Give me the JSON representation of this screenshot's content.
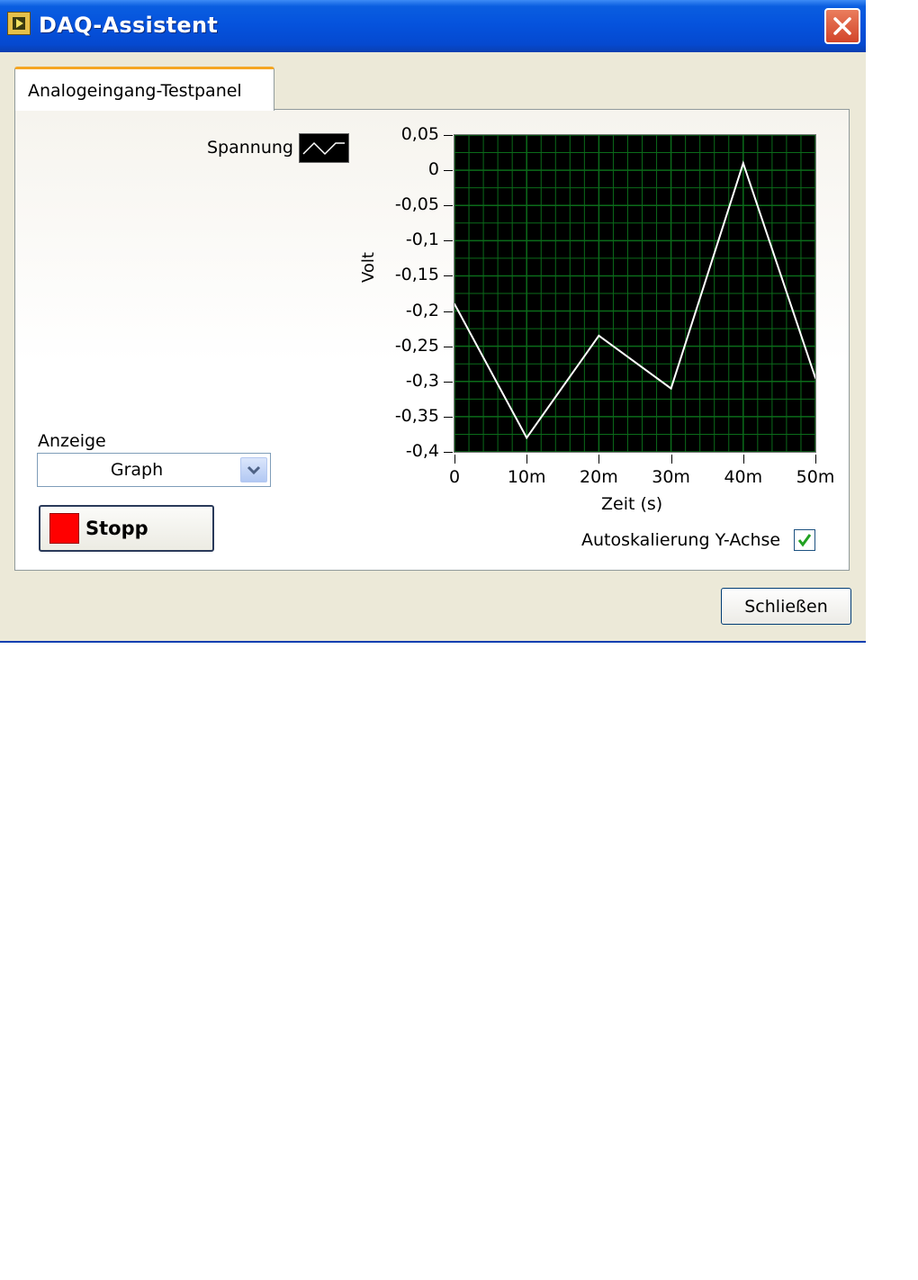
{
  "window": {
    "title": "DAQ-Assistent",
    "close_icon": "close-icon",
    "app_icon": "labview-icon"
  },
  "tabs": [
    {
      "label": "Analogeingang-Testpanel",
      "active": true
    }
  ],
  "legend": {
    "label": "Spannung"
  },
  "display": {
    "label": "Anzeige",
    "selected": "Graph"
  },
  "stop_button": {
    "label": "Stopp",
    "color": "#ff0000"
  },
  "autoscale": {
    "label": "Autoskalierung Y-Achse",
    "checked": true
  },
  "footer": {
    "close_label": "Schließen"
  },
  "chart_data": {
    "type": "line",
    "xlabel": "Zeit (s)",
    "ylabel": "Volt",
    "x": [
      0,
      0.01,
      0.02,
      0.03,
      0.04,
      0.05
    ],
    "x_tick_labels": [
      "0",
      "10m",
      "20m",
      "30m",
      "40m",
      "50m"
    ],
    "y_tick_values": [
      0.05,
      0,
      -0.05,
      -0.1,
      -0.15,
      -0.2,
      -0.25,
      -0.3,
      -0.35,
      -0.4
    ],
    "y_tick_labels": [
      "0,05",
      "0",
      "-0,05",
      "-0,1",
      "-0,15",
      "-0,2",
      "-0,25",
      "-0,3",
      "-0,35",
      "-0,4"
    ],
    "series": [
      {
        "name": "Spannung",
        "values": [
          -0.19,
          -0.38,
          -0.235,
          -0.31,
          0.01,
          -0.295
        ],
        "color": "#ffffff"
      }
    ],
    "xlim": [
      0,
      0.05
    ],
    "ylim": [
      -0.4,
      0.05
    ],
    "grid": true,
    "background": "#000000",
    "grid_color": "#0b6b1a",
    "legend_placement": "top-left"
  }
}
